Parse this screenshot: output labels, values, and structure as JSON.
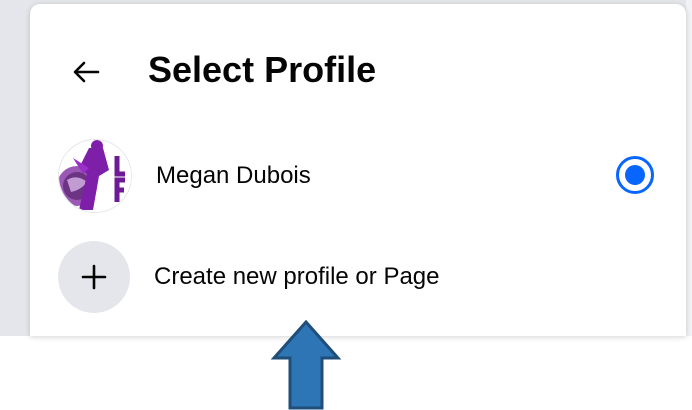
{
  "dialog": {
    "title": "Select Profile",
    "back_icon": "arrow-left-icon"
  },
  "profiles": [
    {
      "name": "Megan Dubois",
      "selected": true,
      "avatar_icon": "profile-avatar"
    }
  ],
  "create_action": {
    "label": "Create new profile or Page",
    "icon": "plus-icon"
  },
  "annotation": {
    "icon": "up-arrow-pointer-icon",
    "fill_color": "#2e75b6",
    "stroke_color": "#1f4e79"
  },
  "colors": {
    "accent": "#0866ff",
    "text": "#050505",
    "circle_bg": "#e4e6eb",
    "avatar_purple": "#8a2be2"
  }
}
